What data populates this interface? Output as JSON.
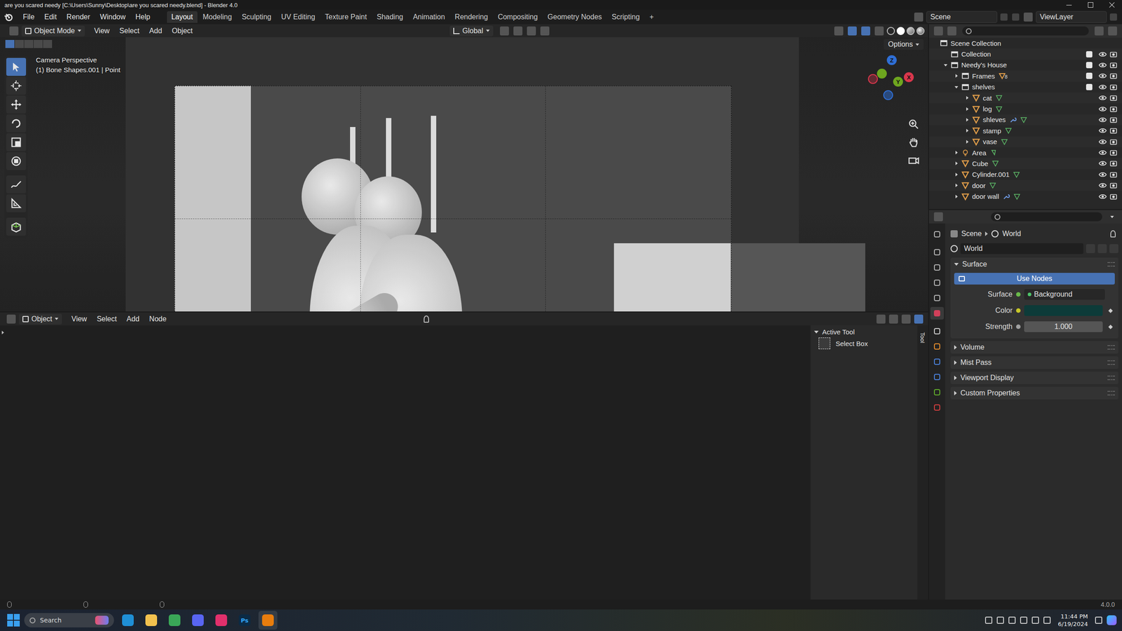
{
  "window": {
    "title": "are you scared needy [C:\\Users\\Sunny\\Desktop\\are you scared needy.blend] - Blender 4.0"
  },
  "menus": [
    "File",
    "Edit",
    "Render",
    "Window",
    "Help"
  ],
  "workspaces": [
    {
      "label": "Layout",
      "selected": true
    },
    {
      "label": "Modeling",
      "selected": false
    },
    {
      "label": "Sculpting",
      "selected": false
    },
    {
      "label": "UV Editing",
      "selected": false
    },
    {
      "label": "Texture Paint",
      "selected": false
    },
    {
      "label": "Shading",
      "selected": false
    },
    {
      "label": "Animation",
      "selected": false
    },
    {
      "label": "Rendering",
      "selected": false
    },
    {
      "label": "Compositing",
      "selected": false
    },
    {
      "label": "Geometry Nodes",
      "selected": false
    },
    {
      "label": "Scripting",
      "selected": false
    }
  ],
  "add_workspace": "+",
  "scene": "Scene",
  "view_layer": "ViewLayer",
  "viewport": {
    "mode": "Object Mode",
    "menus": [
      "View",
      "Select",
      "Add",
      "Object"
    ],
    "orientation": "Global",
    "options": "Options",
    "overlay_title": "Camera Perspective",
    "overlay_info": "(1) Bone Shapes.001 | Point",
    "axes": [
      {
        "label": "Z",
        "color": "#2f6fd6"
      },
      {
        "label": "X",
        "color": "#d9374c"
      },
      {
        "label": "Y",
        "color": "#6ea61f"
      }
    ]
  },
  "toolbar": [
    {
      "kind": "select",
      "selected": true
    },
    {
      "kind": "cursor",
      "selected": false
    },
    {
      "kind": "move",
      "selected": false
    },
    {
      "kind": "rotate",
      "selected": false
    },
    {
      "kind": "scale",
      "selected": false
    },
    {
      "kind": "transform",
      "selected": false
    },
    {
      "kind": "annotate",
      "selected": false
    },
    {
      "kind": "measure",
      "selected": false
    },
    {
      "kind": "add",
      "selected": false
    }
  ],
  "outliner": [
    {
      "name": "Scene Collection",
      "depth": 0,
      "kind": "collection",
      "has_children": false,
      "expanded": false,
      "excludable": false,
      "checked": false,
      "modifier": false,
      "badge": ""
    },
    {
      "name": "Collection",
      "depth": 1,
      "kind": "collection",
      "has_children": false,
      "expanded": false,
      "excludable": true,
      "checked": true,
      "modifier": false,
      "badge": ""
    },
    {
      "name": "Needy's House",
      "depth": 1,
      "kind": "collection",
      "has_children": true,
      "expanded": true,
      "excludable": true,
      "checked": true,
      "modifier": false,
      "badge": ""
    },
    {
      "name": "Frames",
      "depth": 2,
      "kind": "collection",
      "has_children": true,
      "expanded": false,
      "excludable": true,
      "checked": true,
      "modifier": false,
      "badge": "8"
    },
    {
      "name": "shelves",
      "depth": 2,
      "kind": "collection",
      "has_children": true,
      "expanded": true,
      "excludable": true,
      "checked": true,
      "modifier": false,
      "badge": ""
    },
    {
      "name": "cat",
      "depth": 3,
      "kind": "object",
      "has_children": true,
      "expanded": false,
      "excludable": false,
      "checked": false,
      "modifier": false,
      "badge": ""
    },
    {
      "name": "log",
      "depth": 3,
      "kind": "object",
      "has_children": true,
      "expanded": false,
      "excludable": false,
      "checked": false,
      "modifier": false,
      "badge": ""
    },
    {
      "name": "shleves",
      "depth": 3,
      "kind": "object",
      "has_children": true,
      "expanded": false,
      "excludable": false,
      "checked": false,
      "modifier": true,
      "badge": ""
    },
    {
      "name": "stamp",
      "depth": 3,
      "kind": "object",
      "has_children": true,
      "expanded": false,
      "excludable": false,
      "checked": false,
      "modifier": false,
      "badge": ""
    },
    {
      "name": "vase",
      "depth": 3,
      "kind": "object",
      "has_children": true,
      "expanded": false,
      "excludable": false,
      "checked": false,
      "modifier": false,
      "badge": ""
    },
    {
      "name": "Area",
      "depth": 2,
      "kind": "light",
      "has_children": true,
      "expanded": false,
      "excludable": false,
      "checked": false,
      "modifier": false,
      "badge": ""
    },
    {
      "name": "Cube",
      "depth": 2,
      "kind": "object",
      "has_children": true,
      "expanded": false,
      "excludable": false,
      "checked": false,
      "modifier": false,
      "badge": ""
    },
    {
      "name": "Cylinder.001",
      "depth": 2,
      "kind": "object",
      "has_children": true,
      "expanded": false,
      "excludable": false,
      "checked": false,
      "modifier": false,
      "badge": ""
    },
    {
      "name": "door",
      "depth": 2,
      "kind": "object",
      "has_children": true,
      "expanded": false,
      "excludable": false,
      "checked": false,
      "modifier": false,
      "badge": ""
    },
    {
      "name": "door wall",
      "depth": 2,
      "kind": "object",
      "has_children": true,
      "expanded": false,
      "excludable": false,
      "checked": false,
      "modifier": true,
      "badge": ""
    }
  ],
  "property_tabs": [
    {
      "kind": "tool",
      "selected": false
    },
    {
      "kind": "render",
      "selected": false
    },
    {
      "kind": "output",
      "selected": false
    },
    {
      "kind": "view_layer",
      "selected": false
    },
    {
      "kind": "scene",
      "selected": false
    },
    {
      "kind": "world",
      "selected": true
    },
    {
      "kind": "collection",
      "selected": false
    },
    {
      "kind": "object",
      "selected": false
    },
    {
      "kind": "physics",
      "selected": false
    },
    {
      "kind": "constraints",
      "selected": false
    },
    {
      "kind": "data",
      "selected": false
    },
    {
      "kind": "texture",
      "selected": false
    }
  ],
  "properties": {
    "breadcrumb": [
      "Scene",
      "World"
    ],
    "datablock": "World",
    "surface_panel": {
      "title": "Surface",
      "expanded": true,
      "use_nodes": "Use Nodes",
      "rows": [
        {
          "label": "Surface",
          "kind": "node",
          "value": "Background"
        },
        {
          "label": "Color",
          "kind": "color",
          "value": "",
          "color": "#0d3b39"
        },
        {
          "label": "Strength",
          "kind": "number",
          "value": "1.000"
        }
      ]
    },
    "panels": [
      {
        "title": "Volume",
        "expanded": false
      },
      {
        "title": "Mist Pass",
        "expanded": false
      },
      {
        "title": "Viewport Display",
        "expanded": false
      },
      {
        "title": "Custom Properties",
        "expanded": false
      }
    ]
  },
  "node_editor": {
    "mode": "Object",
    "menus": [
      "View",
      "Select",
      "Add",
      "Node"
    ],
    "sidebar_panel": "Active Tool",
    "tool": "Select Box",
    "tab": "Tool"
  },
  "status_bar": {
    "version": "4.0.0"
  },
  "taskbar": {
    "search": "Search",
    "apps": [
      {
        "kind": "edge",
        "label": ""
      },
      {
        "kind": "explorer",
        "label": ""
      },
      {
        "kind": "chrome",
        "label": ""
      },
      {
        "kind": "discord",
        "label": ""
      },
      {
        "kind": "instagram",
        "label": ""
      },
      {
        "kind": "photoshop",
        "label": "Ps"
      },
      {
        "kind": "blender",
        "label": ""
      }
    ],
    "time": "11:44 PM",
    "date": "6/19/2024"
  }
}
